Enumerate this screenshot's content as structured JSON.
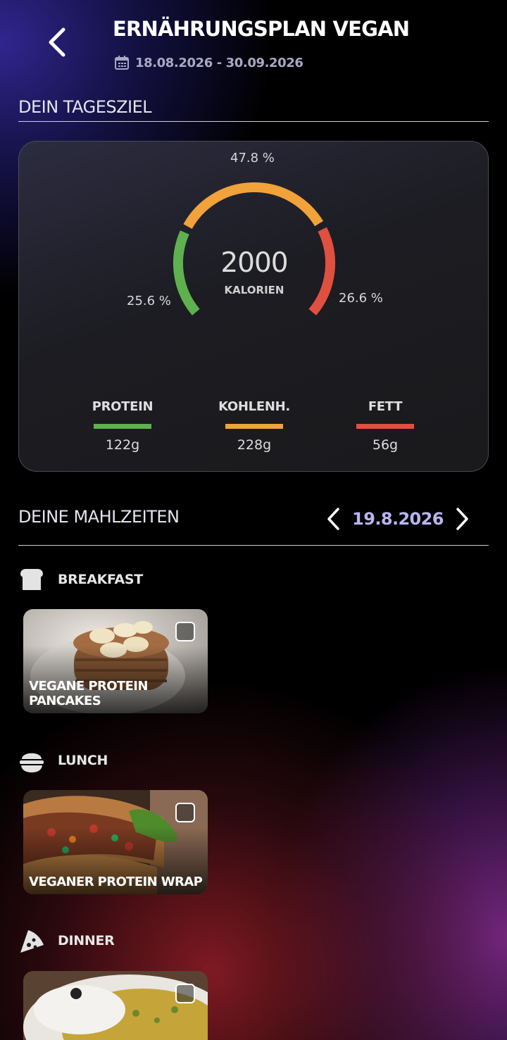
{
  "header": {
    "title": "ERNÄHRUNGSPLAN VEGAN",
    "date_range": "18.08.2026 - 30.09.2026"
  },
  "goal": {
    "section_title": "DEIN TAGESZIEL",
    "calories": "2000",
    "calories_label": "KALORIEN",
    "pct_carbs": "47.8 %",
    "pct_protein": "25.6 %",
    "pct_fat": "26.6 %",
    "gauge_shares": {
      "protein": 25.6,
      "carbs": 47.8,
      "fat": 26.6
    },
    "macros": [
      {
        "name": "PROTEIN",
        "value": "122g",
        "color": "#5fb04f"
      },
      {
        "name": "KOHLENH.",
        "value": "228g",
        "color": "#f2a23a"
      },
      {
        "name": "FETT",
        "value": "56g",
        "color": "#e0503f"
      }
    ]
  },
  "meals_section": {
    "title": "DEINE MAHLZEITEN",
    "current_date": "19.8.2026",
    "meals": [
      {
        "category": "BREAKFAST",
        "icon": "bread-icon",
        "dish": "VEGANE PROTEIN PANCAKES",
        "checked": false
      },
      {
        "category": "LUNCH",
        "icon": "rice-bowl-icon",
        "dish": "VEGANER PROTEIN WRAP",
        "checked": false
      },
      {
        "category": "DINNER",
        "icon": "pizza-slice-icon",
        "dish": "",
        "checked": false
      }
    ]
  },
  "colors": {
    "accent_date": "#b9b5ee",
    "protein": "#5fb04f",
    "carbs": "#f2a23a",
    "fat": "#e0503f"
  }
}
